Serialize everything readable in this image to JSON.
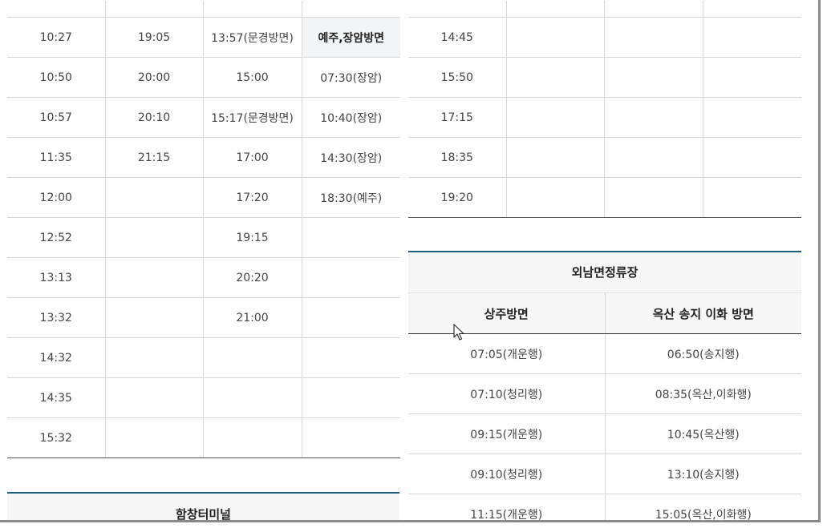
{
  "left_table": {
    "rows": [
      [
        "10:27",
        "19:05",
        "13:57(문경방면)",
        "예주,장암방면"
      ],
      [
        "10:50",
        "20:00",
        "15:00",
        "07:30(장암)"
      ],
      [
        "10:57",
        "20:10",
        "15:17(문경방면)",
        "10:40(장암)"
      ],
      [
        "11:35",
        "21:15",
        "17:00",
        "14:30(장암)"
      ],
      [
        "12:00",
        "",
        "17:20",
        "18:30(예주)"
      ],
      [
        "12:52",
        "",
        "19:15",
        ""
      ],
      [
        "13:13",
        "",
        "20:20",
        ""
      ],
      [
        "13:32",
        "",
        "21:00",
        ""
      ],
      [
        "14:32",
        "",
        "",
        ""
      ],
      [
        "14:35",
        "",
        "",
        ""
      ],
      [
        "15:32",
        "",
        "",
        ""
      ]
    ]
  },
  "right_table": {
    "rows": [
      [
        "14:45",
        "",
        "",
        ""
      ],
      [
        "15:50",
        "",
        "",
        ""
      ],
      [
        "17:15",
        "",
        "",
        ""
      ],
      [
        "18:35",
        "",
        "",
        ""
      ],
      [
        "19:20",
        "",
        "",
        ""
      ]
    ]
  },
  "oenam": {
    "title": "외남면정류장",
    "headers": [
      "상주방면",
      "옥산 송지 이화 방면"
    ],
    "rows": [
      [
        "07:05(개운행)",
        "06:50(송지행)"
      ],
      [
        "07:10(청리행)",
        "08:35(옥산,이화행)"
      ],
      [
        "09:15(개운행)",
        "10:45(옥산행)"
      ],
      [
        "09:10(청리행)",
        "13:10(송지행)"
      ],
      [
        "11:15(개운행)",
        "15:05(옥산,이화행)"
      ]
    ]
  },
  "hamchang": {
    "title": "함창터미널"
  },
  "icons": {
    "cursor": "mouse-pointer-icon"
  }
}
